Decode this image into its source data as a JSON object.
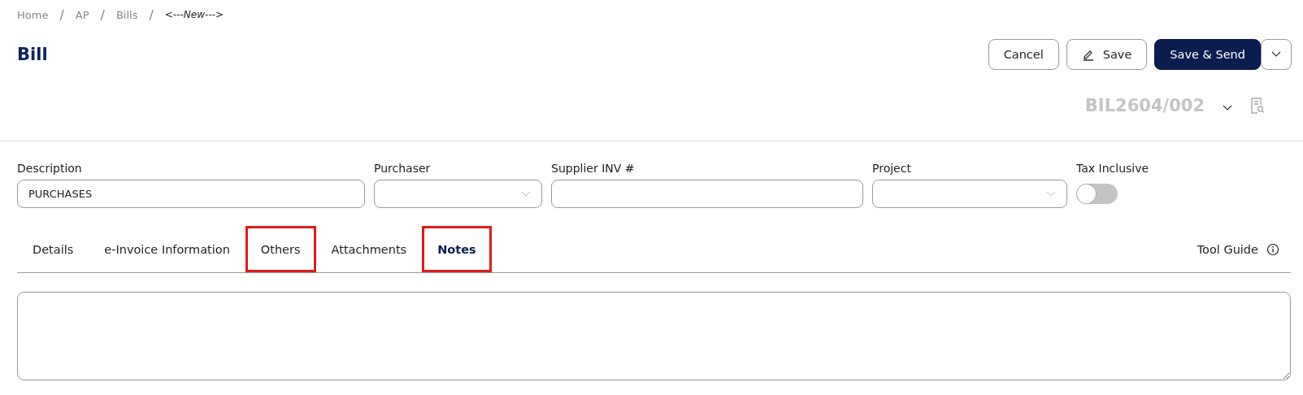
{
  "breadcrumb": [
    {
      "label": "Home",
      "current": false
    },
    {
      "label": "AP",
      "current": false
    },
    {
      "label": "Bills",
      "current": false
    },
    {
      "label": "<---New--->",
      "current": true
    }
  ],
  "breadcrumb_separator": "/",
  "page_title": "Bill",
  "buttons": [
    {
      "kind": "outline",
      "label": "Cancel"
    },
    {
      "kind": "outline-icon",
      "label": "Save"
    },
    {
      "kind": "primary",
      "label": "Save & Send"
    },
    {
      "kind": "caret"
    }
  ],
  "document_number": "BIL2604/002",
  "fields": [
    {
      "kind": "text",
      "label": "Description",
      "value": "PURCHASES"
    },
    {
      "kind": "select",
      "label": "Purchaser"
    },
    {
      "kind": "text",
      "label": "Supplier INV #"
    },
    {
      "kind": "select",
      "label": "Project"
    },
    {
      "kind": "toggle",
      "label": "Tax Inclusive",
      "on": false
    }
  ],
  "tabs": [
    {
      "label": "Details",
      "selected": false,
      "highlighted": false
    },
    {
      "label": "e-Invoice Information",
      "selected": false,
      "highlighted": false
    },
    {
      "label": "Others",
      "selected": false,
      "highlighted": true
    },
    {
      "label": "Attachments",
      "selected": false,
      "highlighted": false
    },
    {
      "label": "Notes",
      "selected": true,
      "highlighted": true
    }
  ],
  "tool_guide": "Tool Guide"
}
